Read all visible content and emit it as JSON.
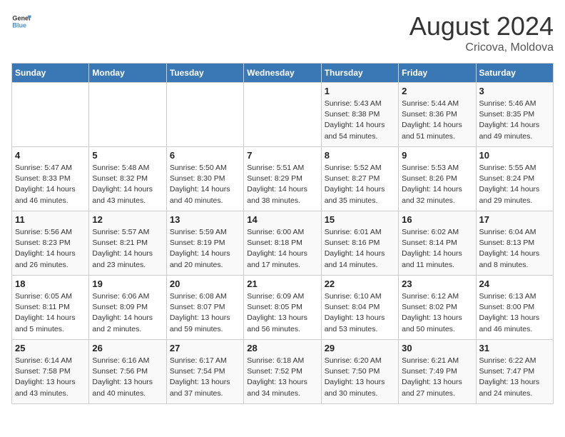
{
  "header": {
    "logo_line1": "General",
    "logo_line2": "Blue",
    "month_year": "August 2024",
    "location": "Cricova, Moldova"
  },
  "days_of_week": [
    "Sunday",
    "Monday",
    "Tuesday",
    "Wednesday",
    "Thursday",
    "Friday",
    "Saturday"
  ],
  "weeks": [
    [
      {
        "day": "",
        "info": ""
      },
      {
        "day": "",
        "info": ""
      },
      {
        "day": "",
        "info": ""
      },
      {
        "day": "",
        "info": ""
      },
      {
        "day": "1",
        "info": "Sunrise: 5:43 AM\nSunset: 8:38 PM\nDaylight: 14 hours\nand 54 minutes."
      },
      {
        "day": "2",
        "info": "Sunrise: 5:44 AM\nSunset: 8:36 PM\nDaylight: 14 hours\nand 51 minutes."
      },
      {
        "day": "3",
        "info": "Sunrise: 5:46 AM\nSunset: 8:35 PM\nDaylight: 14 hours\nand 49 minutes."
      }
    ],
    [
      {
        "day": "4",
        "info": "Sunrise: 5:47 AM\nSunset: 8:33 PM\nDaylight: 14 hours\nand 46 minutes."
      },
      {
        "day": "5",
        "info": "Sunrise: 5:48 AM\nSunset: 8:32 PM\nDaylight: 14 hours\nand 43 minutes."
      },
      {
        "day": "6",
        "info": "Sunrise: 5:50 AM\nSunset: 8:30 PM\nDaylight: 14 hours\nand 40 minutes."
      },
      {
        "day": "7",
        "info": "Sunrise: 5:51 AM\nSunset: 8:29 PM\nDaylight: 14 hours\nand 38 minutes."
      },
      {
        "day": "8",
        "info": "Sunrise: 5:52 AM\nSunset: 8:27 PM\nDaylight: 14 hours\nand 35 minutes."
      },
      {
        "day": "9",
        "info": "Sunrise: 5:53 AM\nSunset: 8:26 PM\nDaylight: 14 hours\nand 32 minutes."
      },
      {
        "day": "10",
        "info": "Sunrise: 5:55 AM\nSunset: 8:24 PM\nDaylight: 14 hours\nand 29 minutes."
      }
    ],
    [
      {
        "day": "11",
        "info": "Sunrise: 5:56 AM\nSunset: 8:23 PM\nDaylight: 14 hours\nand 26 minutes."
      },
      {
        "day": "12",
        "info": "Sunrise: 5:57 AM\nSunset: 8:21 PM\nDaylight: 14 hours\nand 23 minutes."
      },
      {
        "day": "13",
        "info": "Sunrise: 5:59 AM\nSunset: 8:19 PM\nDaylight: 14 hours\nand 20 minutes."
      },
      {
        "day": "14",
        "info": "Sunrise: 6:00 AM\nSunset: 8:18 PM\nDaylight: 14 hours\nand 17 minutes."
      },
      {
        "day": "15",
        "info": "Sunrise: 6:01 AM\nSunset: 8:16 PM\nDaylight: 14 hours\nand 14 minutes."
      },
      {
        "day": "16",
        "info": "Sunrise: 6:02 AM\nSunset: 8:14 PM\nDaylight: 14 hours\nand 11 minutes."
      },
      {
        "day": "17",
        "info": "Sunrise: 6:04 AM\nSunset: 8:13 PM\nDaylight: 14 hours\nand 8 minutes."
      }
    ],
    [
      {
        "day": "18",
        "info": "Sunrise: 6:05 AM\nSunset: 8:11 PM\nDaylight: 14 hours\nand 5 minutes."
      },
      {
        "day": "19",
        "info": "Sunrise: 6:06 AM\nSunset: 8:09 PM\nDaylight: 14 hours\nand 2 minutes."
      },
      {
        "day": "20",
        "info": "Sunrise: 6:08 AM\nSunset: 8:07 PM\nDaylight: 13 hours\nand 59 minutes."
      },
      {
        "day": "21",
        "info": "Sunrise: 6:09 AM\nSunset: 8:05 PM\nDaylight: 13 hours\nand 56 minutes."
      },
      {
        "day": "22",
        "info": "Sunrise: 6:10 AM\nSunset: 8:04 PM\nDaylight: 13 hours\nand 53 minutes."
      },
      {
        "day": "23",
        "info": "Sunrise: 6:12 AM\nSunset: 8:02 PM\nDaylight: 13 hours\nand 50 minutes."
      },
      {
        "day": "24",
        "info": "Sunrise: 6:13 AM\nSunset: 8:00 PM\nDaylight: 13 hours\nand 46 minutes."
      }
    ],
    [
      {
        "day": "25",
        "info": "Sunrise: 6:14 AM\nSunset: 7:58 PM\nDaylight: 13 hours\nand 43 minutes."
      },
      {
        "day": "26",
        "info": "Sunrise: 6:16 AM\nSunset: 7:56 PM\nDaylight: 13 hours\nand 40 minutes."
      },
      {
        "day": "27",
        "info": "Sunrise: 6:17 AM\nSunset: 7:54 PM\nDaylight: 13 hours\nand 37 minutes."
      },
      {
        "day": "28",
        "info": "Sunrise: 6:18 AM\nSunset: 7:52 PM\nDaylight: 13 hours\nand 34 minutes."
      },
      {
        "day": "29",
        "info": "Sunrise: 6:20 AM\nSunset: 7:50 PM\nDaylight: 13 hours\nand 30 minutes."
      },
      {
        "day": "30",
        "info": "Sunrise: 6:21 AM\nSunset: 7:49 PM\nDaylight: 13 hours\nand 27 minutes."
      },
      {
        "day": "31",
        "info": "Sunrise: 6:22 AM\nSunset: 7:47 PM\nDaylight: 13 hours\nand 24 minutes."
      }
    ]
  ]
}
